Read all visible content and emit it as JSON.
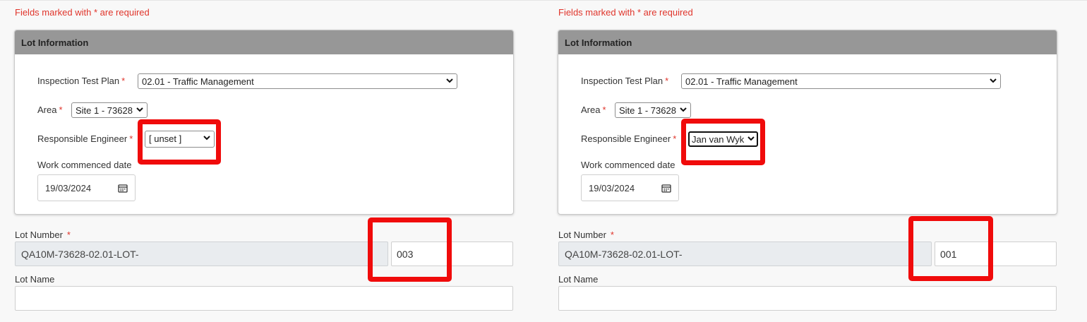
{
  "required_note": "Fields marked with * are required",
  "required_marker": "*",
  "colors": {
    "required": "#e0352b",
    "panel_header": "#979797",
    "highlight": "#f00b0b",
    "readonly_bg": "#e9ecef"
  },
  "icons": {
    "dropdown": "chevron-down-icon",
    "date_picker": "calendar-icon"
  },
  "forms": [
    {
      "panel_title": "Lot Information",
      "itp_label": "Inspection Test Plan",
      "itp_value": "02.01 - Traffic Management",
      "area_label": "Area",
      "area_value": "Site 1 - 73628",
      "engineer_label": "Responsible Engineer",
      "engineer_value": "[ unset ]",
      "work_date_label": "Work commenced date",
      "work_date_value": "19/03/2024",
      "lot_number_label": "Lot Number",
      "lot_prefix": "QA10M-73628-02.01-LOT-",
      "lot_suffix": "003",
      "lot_name_label": "Lot Name",
      "lot_name_value": ""
    },
    {
      "panel_title": "Lot Information",
      "itp_label": "Inspection Test Plan",
      "itp_value": "02.01 - Traffic Management",
      "area_label": "Area",
      "area_value": "Site 1 - 73628",
      "engineer_label": "Responsible Engineer",
      "engineer_value": "Jan van Wyk",
      "work_date_label": "Work commenced date",
      "work_date_value": "19/03/2024",
      "lot_number_label": "Lot Number",
      "lot_prefix": "QA10M-73628-02.01-LOT-",
      "lot_suffix": "001",
      "lot_name_label": "Lot Name",
      "lot_name_value": ""
    }
  ]
}
